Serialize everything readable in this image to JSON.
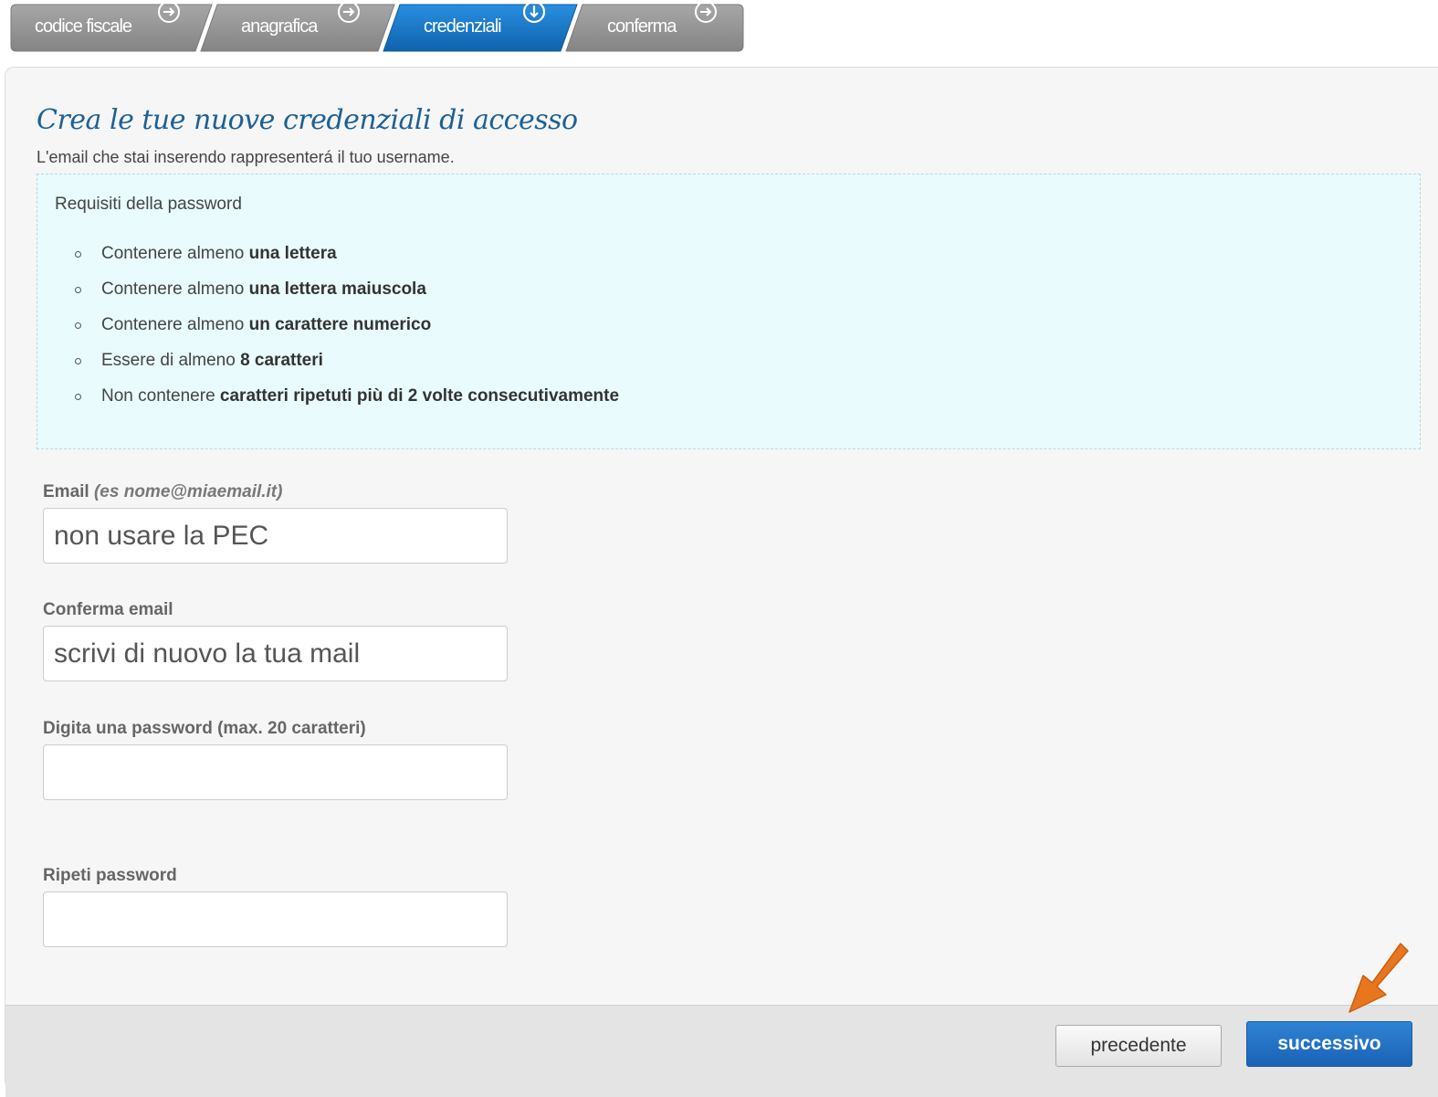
{
  "stepper": {
    "steps": [
      {
        "label": "codice fiscale",
        "icon": "arrow-right-circle-icon",
        "state": "inactive"
      },
      {
        "label": "anagrafica",
        "icon": "arrow-right-circle-icon",
        "state": "inactive"
      },
      {
        "label": "credenziali",
        "icon": "arrow-down-circle-icon",
        "state": "active"
      },
      {
        "label": "conferma",
        "icon": "arrow-right-circle-icon",
        "state": "inactive"
      }
    ]
  },
  "content": {
    "title": "Crea le tue nuove credenziali di accesso",
    "subtitle": "L'email che stai inserendo rappresenterá il tuo username.",
    "requirements": {
      "title": "Requisiti della password",
      "items": [
        {
          "plain": "Contenere almeno ",
          "bold": "una lettera"
        },
        {
          "plain": "Contenere almeno ",
          "bold": "una lettera maiuscola"
        },
        {
          "plain": "Contenere almeno ",
          "bold": "un carattere numerico"
        },
        {
          "plain": "Essere di almeno ",
          "bold": "8 caratteri"
        },
        {
          "plain": "Non contenere ",
          "bold": "caratteri ripetuti più di 2 volte consecutivamente"
        }
      ]
    }
  },
  "form": {
    "email": {
      "label": "Email",
      "hint": "(es nome@miaemail.it)",
      "placeholder": "non usare la PEC",
      "value": ""
    },
    "confirm_email": {
      "label": "Conferma email",
      "placeholder": "scrivi di nuovo la tua mail",
      "value": ""
    },
    "password": {
      "label": "Digita una password (max. 20 caratteri)",
      "placeholder": "",
      "value": ""
    },
    "repeat_password": {
      "label": "Ripeti password",
      "placeholder": "",
      "value": ""
    }
  },
  "footer": {
    "prev_label": "precedente",
    "next_label": "successivo"
  },
  "colors": {
    "step_inactive": "#8f8f8f",
    "step_active": "#1677c5",
    "title_blue": "#1d6195",
    "requirements_bg": "#e9fbfc",
    "next_button": "#2272c9",
    "annotation_arrow": "#e8761e"
  }
}
